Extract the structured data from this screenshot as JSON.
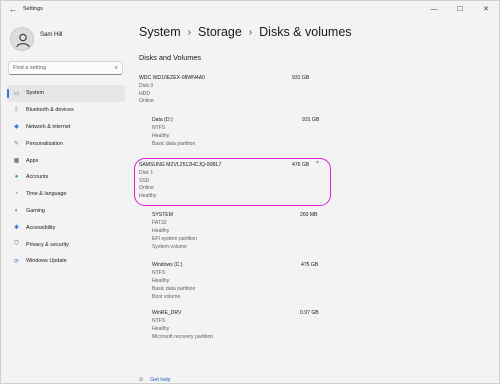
{
  "window": {
    "app_title": "Settings",
    "back_glyph": "←",
    "minimize_glyph": "—",
    "maximize_glyph": "☐",
    "close_glyph": "✕"
  },
  "profile": {
    "user_name": "Sam Hill"
  },
  "search": {
    "placeholder": "Find a setting",
    "icon": "search-icon"
  },
  "sidebar": {
    "accent_color": "#2f7bd3",
    "items": [
      {
        "label": "System",
        "icon": "system-icon",
        "glyph": "▭",
        "color": "#2f7bd3",
        "active": true
      },
      {
        "label": "Bluetooth & devices",
        "icon": "bluetooth-icon",
        "glyph": "ᛒ",
        "color": "#2f7bd3"
      },
      {
        "label": "Network & internet",
        "icon": "wifi-icon",
        "glyph": "◆",
        "color": "#2f7bd3"
      },
      {
        "label": "Personalization",
        "icon": "brush-icon",
        "glyph": "✎",
        "color": "#b06a2a"
      },
      {
        "label": "Apps",
        "icon": "apps-icon",
        "glyph": "▦",
        "color": "#555555"
      },
      {
        "label": "Accounts",
        "icon": "accounts-icon",
        "glyph": "●",
        "color": "#2aa56b"
      },
      {
        "label": "Time & language",
        "icon": "clock-globe-icon",
        "glyph": "◔",
        "color": "#2f7bd3"
      },
      {
        "label": "Gaming",
        "icon": "gaming-icon",
        "glyph": "◐",
        "color": "#666666"
      },
      {
        "label": "Accessibility",
        "icon": "accessibility-icon",
        "glyph": "✱",
        "color": "#2f7bd3"
      },
      {
        "label": "Privacy & security",
        "icon": "shield-icon",
        "glyph": "⛉",
        "color": "#666666"
      },
      {
        "label": "Windows Update",
        "icon": "windows-update-icon",
        "glyph": "⟳",
        "color": "#2f7bd3"
      }
    ]
  },
  "breadcrumb": {
    "items": [
      "System",
      "Storage",
      "Disks & volumes"
    ],
    "separator": "›"
  },
  "section_title": "Disks and Volumes",
  "disks": [
    {
      "name": "WDC WD10EZEX-08WN4A0",
      "size": "931 GB",
      "details": [
        "Disk 0",
        "HDD",
        "Online"
      ],
      "volumes": [
        {
          "name": "Data (D:)",
          "size": "931 GB",
          "details": [
            "NTFS",
            "Healthy",
            "Basic data partition"
          ]
        }
      ]
    },
    {
      "name": "SAMSUNG MZVL2512HCJQ-00BL7",
      "size": "476 GB",
      "chevron": "^",
      "details": [
        "Disk 1",
        "SSD",
        "Online",
        "Healthy"
      ],
      "highlight_color": "#e020d8",
      "volumes": [
        {
          "name": "SYSTEM",
          "size": "260 MB",
          "details": [
            "FAT32",
            "Healthy",
            "EFI system partition",
            "System volume"
          ]
        },
        {
          "name": "Windows (C:)",
          "size": "475 GB",
          "details": [
            "NTFS",
            "Healthy",
            "Basic data partition",
            "Boot volume"
          ]
        },
        {
          "name": "WinRE_DRV",
          "size": "0.97 GB",
          "details": [
            "NTFS",
            "Healthy",
            "Microsoft recovery partition"
          ]
        }
      ]
    }
  ],
  "help": {
    "label": "Get help",
    "icon": "help-icon"
  }
}
